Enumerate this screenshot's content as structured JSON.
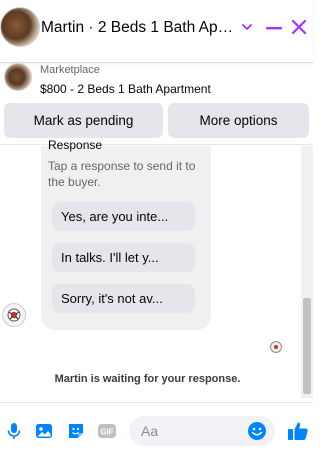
{
  "header": {
    "title": "Martin · 2 Beds 1 Bath Apa..."
  },
  "listing": {
    "source": "Marketplace",
    "title": "$800 - 2 Beds 1 Bath Apartment"
  },
  "actions": {
    "pending_label": "Mark as pending",
    "more_label": "More options"
  },
  "responses": {
    "heading": "Response",
    "hint": "Tap a response to send it to the buyer.",
    "items": [
      "Yes, are you inte...",
      "In talks. I'll let y...",
      "Sorry, it's not av..."
    ]
  },
  "status": {
    "waiting": "Martin is waiting for your response."
  },
  "composer": {
    "placeholder": "Aa",
    "gif_label": "GIF"
  },
  "colors": {
    "accent": "#0084ff",
    "messenger_purple": "#a033ff"
  },
  "icons": [
    "chevron-down-icon",
    "minimize-icon",
    "close-icon",
    "microphone-icon",
    "photo-icon",
    "sticker-icon",
    "gif-icon",
    "emoji-icon",
    "thumbs-up-icon"
  ]
}
